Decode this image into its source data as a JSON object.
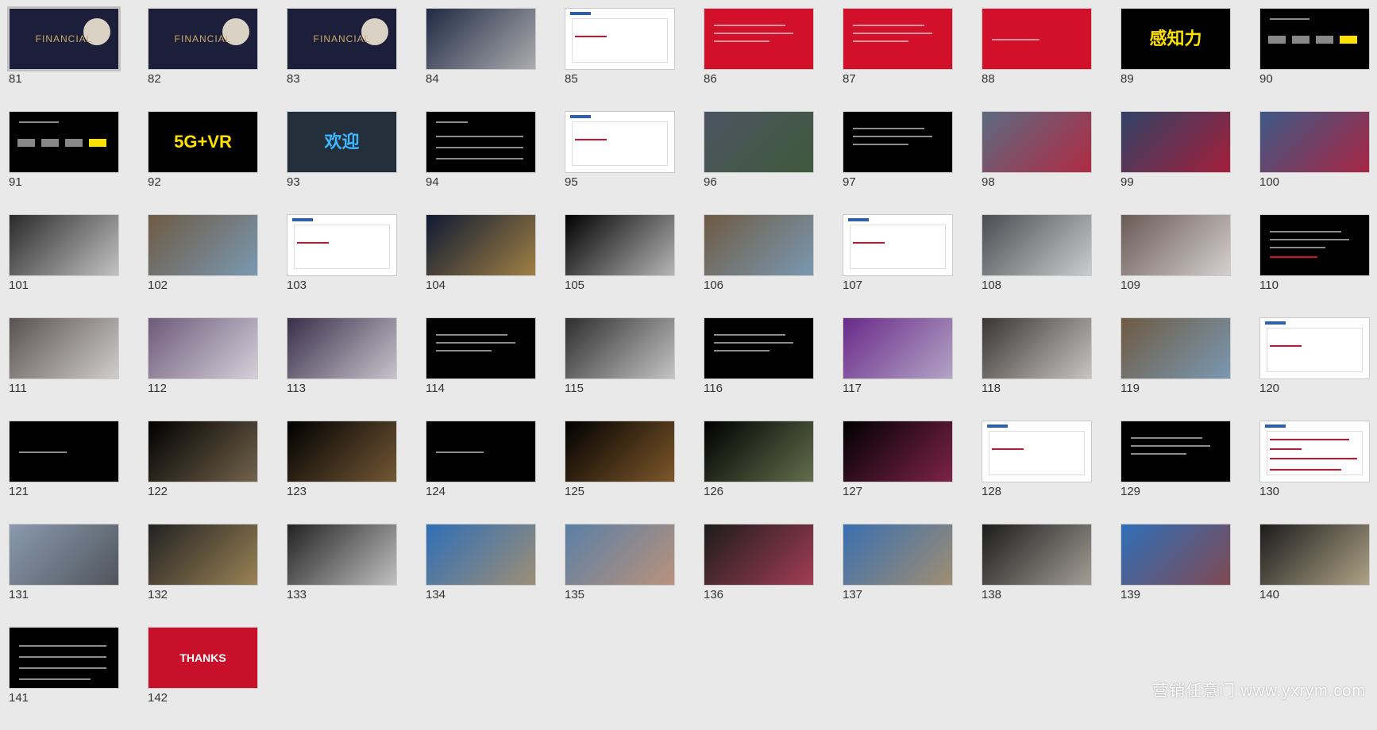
{
  "slides": [
    {
      "n": "81",
      "bg": "#1c1f3a",
      "accent": "#caa86a",
      "caption": "FINANCIAL",
      "style": "cover",
      "selected": true
    },
    {
      "n": "82",
      "bg": "#1c1f3a",
      "accent": "#caa86a",
      "caption": "FINANCIAL",
      "style": "cover"
    },
    {
      "n": "83",
      "bg": "#1c1f3a",
      "accent": "#caa86a",
      "caption": "FINANCIAL",
      "style": "cover"
    },
    {
      "n": "84",
      "bg": "#1f2a44",
      "accent": "#e4e0da",
      "caption": "",
      "style": "photo"
    },
    {
      "n": "85",
      "bg": "#ffffff",
      "accent": "#d2102a",
      "caption": "",
      "style": "white"
    },
    {
      "n": "86",
      "bg": "#d2102a",
      "accent": "#ffffff",
      "caption": "",
      "style": "lines"
    },
    {
      "n": "87",
      "bg": "#d2102a",
      "accent": "#ffffff",
      "caption": "",
      "style": "lines"
    },
    {
      "n": "88",
      "bg": "#d2102a",
      "accent": "#ffffff",
      "caption": "",
      "style": "line1"
    },
    {
      "n": "89",
      "bg": "#000000",
      "accent": "#ffe100",
      "caption": "感知力",
      "style": "big"
    },
    {
      "n": "90",
      "bg": "#000000",
      "accent": "#ffe100",
      "caption": "",
      "style": "flow"
    },
    {
      "n": "91",
      "bg": "#000000",
      "accent": "#ffe100",
      "caption": "",
      "style": "flow"
    },
    {
      "n": "92",
      "bg": "#000000",
      "accent": "#ffe100",
      "caption": "5G+VR",
      "style": "big"
    },
    {
      "n": "93",
      "bg": "#23303c",
      "accent": "#3fb6ff",
      "caption": "欢迎",
      "style": "big"
    },
    {
      "n": "94",
      "bg": "#000000",
      "accent": "#ffffff",
      "caption": "",
      "style": "table"
    },
    {
      "n": "95",
      "bg": "#ffffff",
      "accent": "#d2102a",
      "caption": "",
      "style": "white"
    },
    {
      "n": "96",
      "bg": "#4b5563",
      "accent": "#3b5a2a",
      "caption": "",
      "style": "photo"
    },
    {
      "n": "97",
      "bg": "#000000",
      "accent": "#ffffff",
      "caption": "",
      "style": "lines"
    },
    {
      "n": "98",
      "bg": "#5b6b82",
      "accent": "#d2102a",
      "caption": "",
      "style": "photo"
    },
    {
      "n": "99",
      "bg": "#304266",
      "accent": "#d2102a",
      "caption": "",
      "style": "photo"
    },
    {
      "n": "100",
      "bg": "#3d5a86",
      "accent": "#d2102a",
      "caption": "",
      "style": "photo"
    },
    {
      "n": "101",
      "bg": "#2a2a2a",
      "accent": "#ffffff",
      "caption": "",
      "style": "photo"
    },
    {
      "n": "102",
      "bg": "#6e5a44",
      "accent": "#7fb2dd",
      "caption": "",
      "style": "photo"
    },
    {
      "n": "103",
      "bg": "#ffffff",
      "accent": "#d2102a",
      "caption": "",
      "style": "white"
    },
    {
      "n": "104",
      "bg": "#0f1a33",
      "accent": "#d9a84a",
      "caption": "",
      "style": "photo"
    },
    {
      "n": "105",
      "bg": "#000000",
      "accent": "#ffffff",
      "caption": "",
      "style": "photo"
    },
    {
      "n": "106",
      "bg": "#6e5a44",
      "accent": "#7fb2dd",
      "caption": "",
      "style": "photo"
    },
    {
      "n": "107",
      "bg": "#ffffff",
      "accent": "#d2102a",
      "caption": "",
      "style": "white"
    },
    {
      "n": "108",
      "bg": "#4a4d52",
      "accent": "#ffffff",
      "caption": "",
      "style": "photo"
    },
    {
      "n": "109",
      "bg": "#6a5a55",
      "accent": "#ffffff",
      "caption": "",
      "style": "photo"
    },
    {
      "n": "110",
      "bg": "#000000",
      "accent": "#d2102a",
      "caption": "",
      "style": "lines"
    },
    {
      "n": "111",
      "bg": "#5a5250",
      "accent": "#ffffff",
      "caption": "",
      "style": "photo"
    },
    {
      "n": "112",
      "bg": "#6d5a7a",
      "accent": "#ffffff",
      "caption": "",
      "style": "photo"
    },
    {
      "n": "113",
      "bg": "#3a2f4a",
      "accent": "#ffffff",
      "caption": "",
      "style": "photo"
    },
    {
      "n": "114",
      "bg": "#000000",
      "accent": "#ffffff",
      "caption": "",
      "style": "lines"
    },
    {
      "n": "115",
      "bg": "#2e2e2e",
      "accent": "#ffffff",
      "caption": "",
      "style": "photo"
    },
    {
      "n": "116",
      "bg": "#000000",
      "accent": "#ffffff",
      "caption": "",
      "style": "lines"
    },
    {
      "n": "117",
      "bg": "#6a2a8a",
      "accent": "#cfd5dc",
      "caption": "",
      "style": "photo"
    },
    {
      "n": "118",
      "bg": "#3a3532",
      "accent": "#ffffff",
      "caption": "",
      "style": "photo"
    },
    {
      "n": "119",
      "bg": "#6e5a44",
      "accent": "#7fb2dd",
      "caption": "",
      "style": "photo"
    },
    {
      "n": "120",
      "bg": "#ffffff",
      "accent": "#d2102a",
      "caption": "",
      "style": "white"
    },
    {
      "n": "121",
      "bg": "#000000",
      "accent": "#ffffff",
      "caption": "",
      "style": "line1"
    },
    {
      "n": "122",
      "bg": "#000000",
      "accent": "#a08a6a",
      "caption": "",
      "style": "photo"
    },
    {
      "n": "123",
      "bg": "#000000",
      "accent": "#a07a4a",
      "caption": "",
      "style": "photo"
    },
    {
      "n": "124",
      "bg": "#000000",
      "accent": "#ffffff",
      "caption": "",
      "style": "line1"
    },
    {
      "n": "125",
      "bg": "#000000",
      "accent": "#b07a3a",
      "caption": "",
      "style": "photo"
    },
    {
      "n": "126",
      "bg": "#000000",
      "accent": "#8a9a6a",
      "caption": "",
      "style": "photo"
    },
    {
      "n": "127",
      "bg": "#000000",
      "accent": "#b0306a",
      "caption": "",
      "style": "photo"
    },
    {
      "n": "128",
      "bg": "#ffffff",
      "accent": "#d2102a",
      "caption": "",
      "style": "white"
    },
    {
      "n": "129",
      "bg": "#000000",
      "accent": "#ffffff",
      "caption": "",
      "style": "lines"
    },
    {
      "n": "130",
      "bg": "#ffffff",
      "accent": "#d2102a",
      "caption": "",
      "style": "timeline"
    },
    {
      "n": "131",
      "bg": "#8a9ab0",
      "accent": "#3a3a3a",
      "caption": "",
      "style": "photo"
    },
    {
      "n": "132",
      "bg": "#222222",
      "accent": "#caa86a",
      "caption": "",
      "style": "photo"
    },
    {
      "n": "133",
      "bg": "#222222",
      "accent": "#ffffff",
      "caption": "",
      "style": "photo"
    },
    {
      "n": "134",
      "bg": "#2f6fb8",
      "accent": "#c89a5a",
      "caption": "",
      "style": "photo"
    },
    {
      "n": "135",
      "bg": "#5a7fa6",
      "accent": "#e09a6a",
      "caption": "",
      "style": "photo"
    },
    {
      "n": "136",
      "bg": "#1c1c1c",
      "accent": "#d94a6a",
      "caption": "",
      "style": "photo"
    },
    {
      "n": "137",
      "bg": "#3a6fb0",
      "accent": "#c89a5a",
      "caption": "",
      "style": "photo"
    },
    {
      "n": "138",
      "bg": "#1c1c1c",
      "accent": "#d8d0c4",
      "caption": "",
      "style": "photo"
    },
    {
      "n": "139",
      "bg": "#2f6fb8",
      "accent": "#a03a2a",
      "caption": "",
      "style": "photo"
    },
    {
      "n": "140",
      "bg": "#1c1c1c",
      "accent": "#e8d7b0",
      "caption": "",
      "style": "photo"
    },
    {
      "n": "141",
      "bg": "#000000",
      "accent": "#ffffff",
      "caption": "",
      "style": "timeline-dark"
    },
    {
      "n": "142",
      "bg": "#c8102a",
      "accent": "#ffffff",
      "caption": "THANKS",
      "style": "mid"
    }
  ],
  "watermark": "营销任意门 www.yxrym.com"
}
